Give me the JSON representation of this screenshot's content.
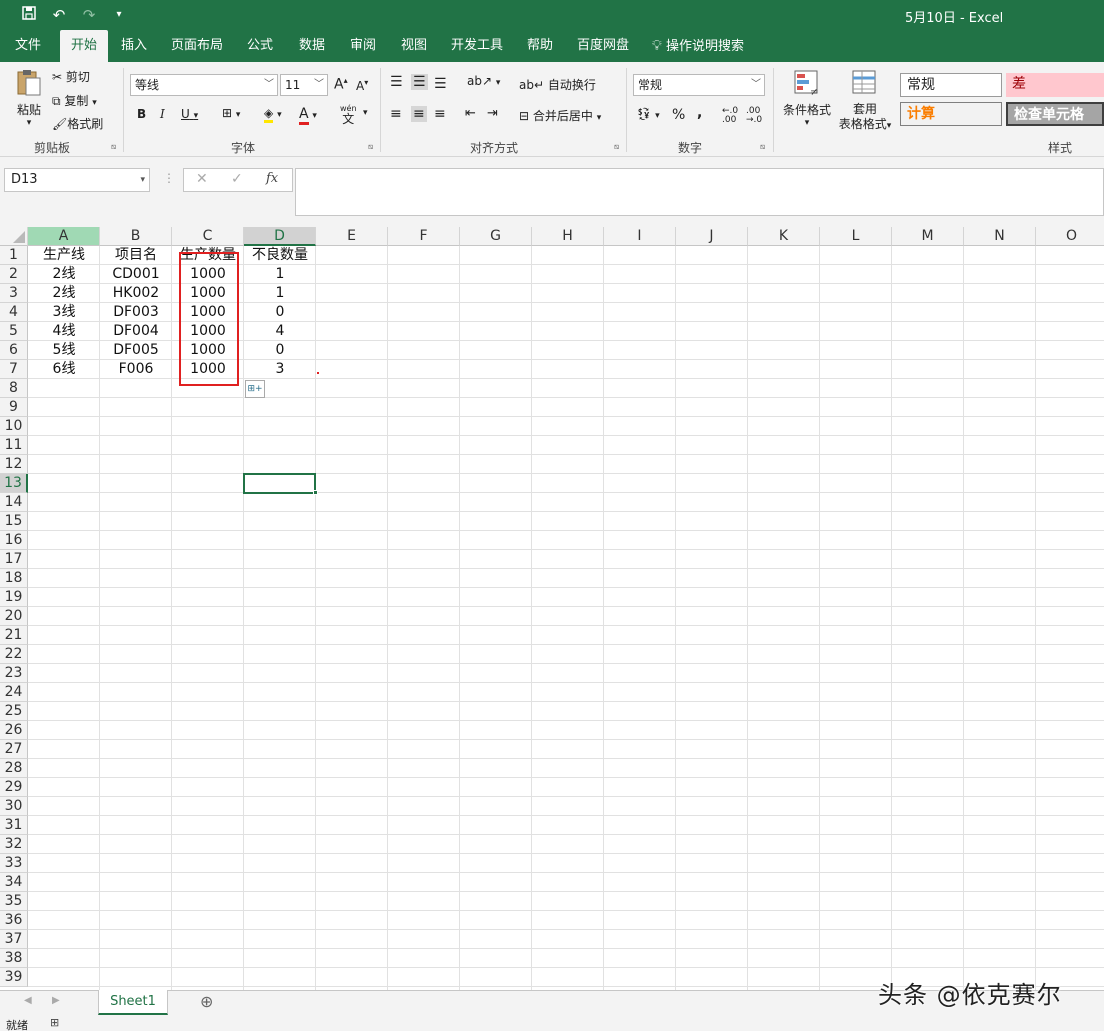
{
  "titlebar": {
    "title": "5月10日  -  Excel",
    "save_icon": "save-icon",
    "undo_icon": "undo-icon",
    "redo_icon": "redo-icon",
    "customize_icon": "customize-qat-icon"
  },
  "menu": {
    "items": [
      "文件",
      "开始",
      "插入",
      "页面布局",
      "公式",
      "数据",
      "审阅",
      "视图",
      "开发工具",
      "帮助",
      "百度网盘"
    ],
    "active": "开始",
    "search": "操作说明搜索"
  },
  "ribbon": {
    "clipboard": {
      "paste": "粘贴",
      "cut": "剪切",
      "copy": "复制",
      "format_painter": "格式刷",
      "label": "剪贴板"
    },
    "font": {
      "font_name": "等线",
      "font_size": "11",
      "grow": "A",
      "shrink": "A",
      "bold": "B",
      "italic": "I",
      "underline": "U",
      "phonetic": "wén",
      "phonetic_sub": "文",
      "font_color_letter": "A",
      "label": "字体"
    },
    "alignment": {
      "wrap_text": "自动换行",
      "merge_center": "合并后居中",
      "label": "对齐方式"
    },
    "number": {
      "format": "常规",
      "percent": "%",
      "comma": ",",
      "label": "数字"
    },
    "styles": {
      "conditional": "条件格式",
      "table_format_line1": "套用",
      "table_format_line2": "表格格式",
      "normal": "常规",
      "bad": "差",
      "calc": "计算",
      "check_cell": "检查单元格",
      "label": "样式"
    }
  },
  "formula_bar": {
    "name_box": "D13",
    "cancel": "✕",
    "enter": "✓",
    "fx": "fx",
    "value": ""
  },
  "sheet": {
    "columns": [
      "A",
      "B",
      "C",
      "D",
      "E",
      "F",
      "G",
      "H",
      "I",
      "J",
      "K",
      "L",
      "M",
      "N",
      "O"
    ],
    "rows": [
      "1",
      "2",
      "3",
      "4",
      "5",
      "6",
      "7",
      "8",
      "9",
      "10",
      "11",
      "12",
      "13",
      "14",
      "15",
      "16",
      "17",
      "18",
      "19",
      "20",
      "21",
      "22",
      "23",
      "24",
      "25",
      "26",
      "27",
      "28",
      "29",
      "30",
      "31",
      "32",
      "33",
      "34",
      "35",
      "36",
      "37",
      "38",
      "39"
    ],
    "selected_cell": "D13",
    "cells": [
      [
        "生产线",
        "项目名",
        "生产数量",
        "不良数量"
      ],
      [
        "2线",
        "CD001",
        "1000",
        "1"
      ],
      [
        "2线",
        "HK002",
        "1000",
        "1"
      ],
      [
        "3线",
        "DF003",
        "1000",
        "0"
      ],
      [
        "4线",
        "DF004",
        "1000",
        "4"
      ],
      [
        "5线",
        "DF005",
        "1000",
        "0"
      ],
      [
        "6线",
        "F006",
        "1000",
        "3"
      ]
    ]
  },
  "tabs": {
    "sheet": "Sheet1",
    "add": "⊕"
  },
  "status": {
    "ready": "就绪"
  },
  "watermark": "头条 @依克赛尔",
  "colors": {
    "excel_green": "#217346",
    "red_box": "#e02020"
  }
}
